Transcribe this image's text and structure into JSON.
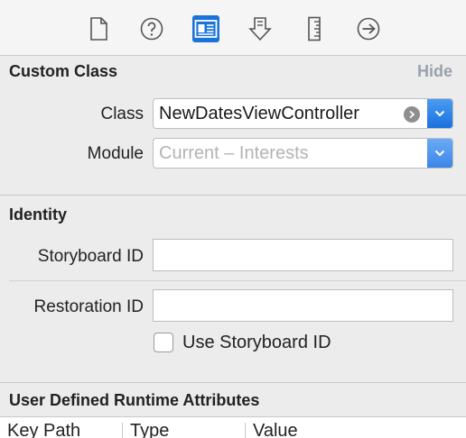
{
  "toolbar": {
    "tabs": [
      {
        "icon": "file-icon"
      },
      {
        "icon": "help-icon"
      },
      {
        "icon": "identity-inspector-icon",
        "active": true
      },
      {
        "icon": "attributes-inspector-icon"
      },
      {
        "icon": "size-inspector-icon"
      },
      {
        "icon": "connections-inspector-icon"
      }
    ]
  },
  "custom_class": {
    "title": "Custom Class",
    "hide_label": "Hide",
    "class_label": "Class",
    "class_value": "NewDatesViewController",
    "module_label": "Module",
    "module_placeholder": "Current – Interests"
  },
  "identity": {
    "title": "Identity",
    "storyboard_id_label": "Storyboard ID",
    "storyboard_id_value": "",
    "restoration_id_label": "Restoration ID",
    "restoration_id_value": "",
    "use_storyboard_id_label": "Use Storyboard ID",
    "use_storyboard_id_checked": false
  },
  "runtime_attributes": {
    "title": "User Defined Runtime Attributes",
    "columns": [
      "Key Path",
      "Type",
      "Value"
    ]
  },
  "colors": {
    "accent": "#1a73d8",
    "hide_link": "#9aa2ad",
    "panel_bg": "#ececec"
  }
}
